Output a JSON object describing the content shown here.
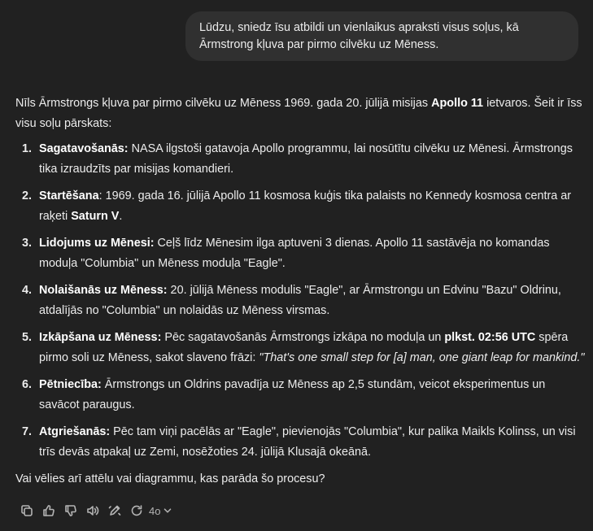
{
  "user_message": "Lūdzu, sniedz īsu atbildi un vienlaikus apraksti visus soļus, kā Ārmstrong kļuva par pirmo cilvēku uz Mēness.",
  "assistant": {
    "intro_pre": "Nīls Ārmstrongs kļuva par pirmo cilvēku uz Mēness 1969. gada 20. jūlijā misijas ",
    "intro_bold": "Apollo 11",
    "intro_post": " ietvaros. Šeit ir īss visu soļu pārskats:",
    "steps": [
      {
        "num": "1.",
        "title": "Sagatavošanās:",
        "text": " NASA ilgstoši gatavoja Apollo programmu, lai nosūtītu cilvēku uz Mēnesi. Ārmstrongs tika izraudzīts par misijas komandieri."
      },
      {
        "num": "2.",
        "title": "Startēšana",
        "text_a": ": 1969. gada 16. jūlijā Apollo 11 kosmosa kuģis tika palaists no Kennedy kosmosa centra ar raķeti ",
        "bold": "Saturn V",
        "text_b": "."
      },
      {
        "num": "3.",
        "title": "Lidojums uz Mēnesi:",
        "text": " Ceļš līdz Mēnesim ilga aptuveni 3 dienas. Apollo 11 sastāvēja no komandas moduļa \"Columbia\" un Mēness moduļa \"Eagle\"."
      },
      {
        "num": "4.",
        "title": "Nolaišanās uz Mēness:",
        "text": " 20. jūlijā Mēness modulis \"Eagle\", ar Ārmstrongu un Edvinu \"Bazu\" Oldrinu, atdalījās no \"Columbia\" un nolaidās uz Mēness virsmas."
      },
      {
        "num": "5.",
        "title": "Izkāpšana uz Mēness:",
        "text_a": " Pēc sagatavošanās Ārmstrongs izkāpa no moduļa un ",
        "bold": "plkst. 02:56 UTC",
        "text_b": " spēra pirmo soli uz Mēness, sakot slaveno frāzi: ",
        "quote": "\"That's one small step for [a] man, one giant leap for mankind.\""
      },
      {
        "num": "6.",
        "title": "Pētniecība:",
        "text": " Ārmstrongs un Oldrins pavadīja uz Mēness ap 2,5 stundām, veicot eksperimentus un savācot paraugus."
      },
      {
        "num": "7.",
        "title": "Atgriešanās:",
        "text": " Pēc tam viņi pacēlās ar \"Eagle\", pievienojās \"Columbia\", kur palika Maikls Kolinss, un visi trīs devās atpakaļ uz Zemi, nosēžoties 24. jūlijā Klusajā okeānā."
      }
    ],
    "outro": "Vai vēlies arī attēlu vai diagrammu, kas parāda šo procesu?"
  },
  "actions": {
    "icons": [
      "copy-icon",
      "thumbs-up-icon",
      "thumbs-down-icon",
      "read-aloud-icon",
      "edit-canvas-icon",
      "regenerate-icon"
    ],
    "model_label": "4o"
  },
  "colors": {
    "background": "#212121",
    "bubble": "#303030",
    "text": "#ececec",
    "muted": "#b4b4b4"
  }
}
